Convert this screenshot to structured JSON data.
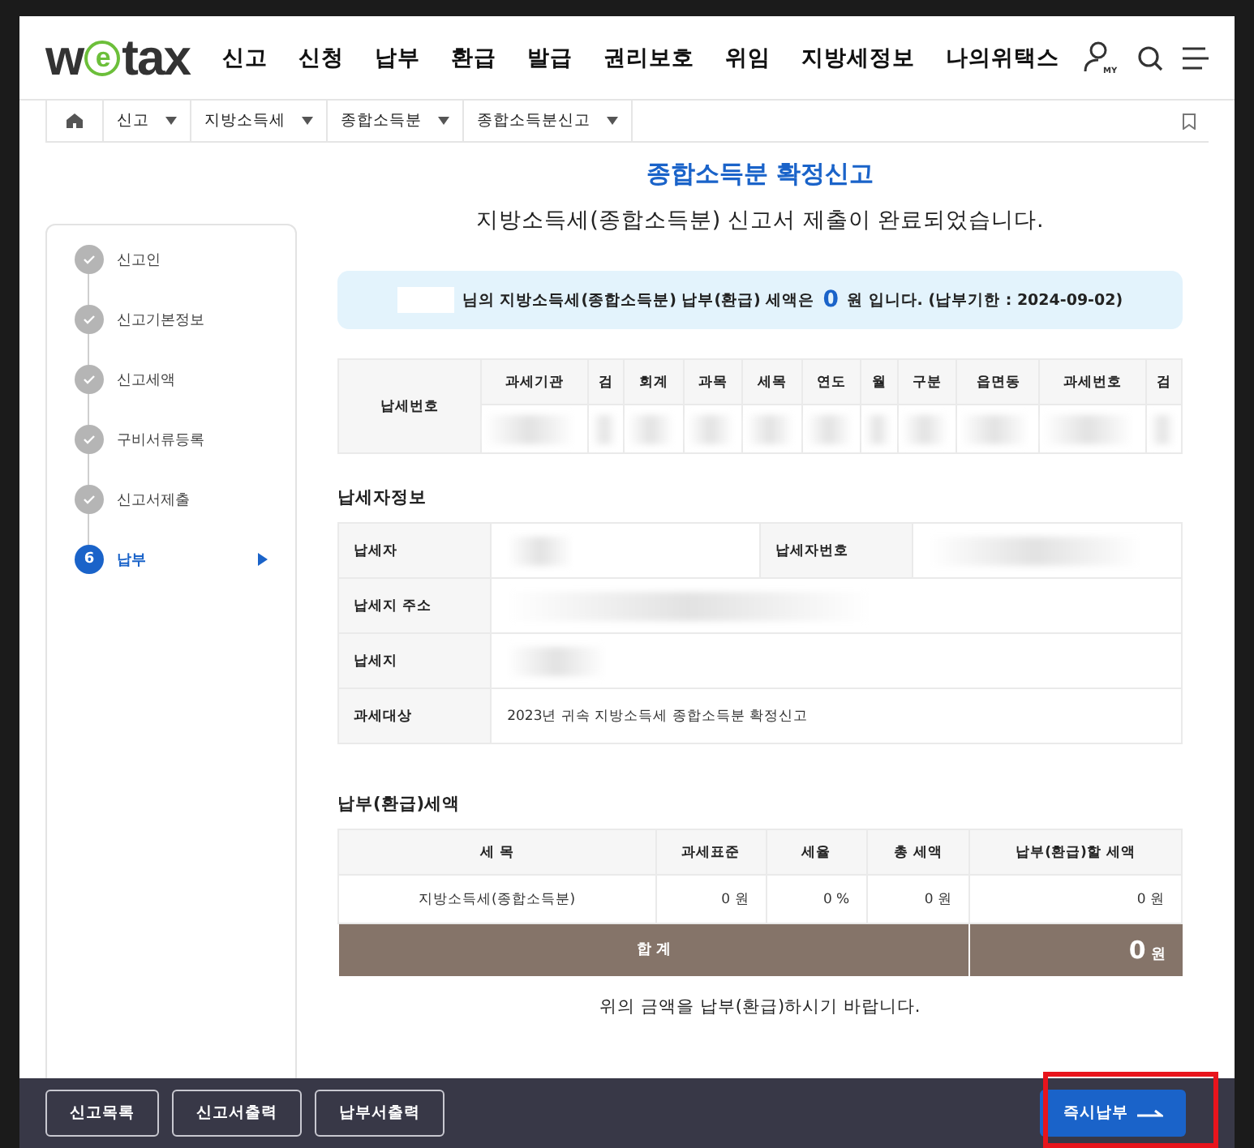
{
  "logo": {
    "before": "w",
    "mark": "e",
    "after": "tax"
  },
  "nav": [
    "신고",
    "신청",
    "납부",
    "환급",
    "발급",
    "권리보호",
    "위임",
    "지방세정보",
    "나의위택스"
  ],
  "my_label": "MY",
  "breadcrumb": [
    "신고",
    "지방소득세",
    "종합소득분",
    "종합소득분신고"
  ],
  "steps": [
    {
      "label": "신고인",
      "done": true,
      "selected": false
    },
    {
      "label": "신고기본정보",
      "done": true,
      "selected": false
    },
    {
      "label": "신고세액",
      "done": true,
      "selected": false
    },
    {
      "label": "구비서류등록",
      "done": true,
      "selected": false
    },
    {
      "label": "신고서제출",
      "done": true,
      "selected": false
    },
    {
      "label": "납부",
      "done": false,
      "selected": true,
      "number": "6"
    }
  ],
  "title": "종합소득분 확정신고",
  "subtitle": "지방소득세(종합소득분) 신고서 제출이 완료되었습니다.",
  "notice": {
    "before": "님의 지방소득세(종합소득분) 납부(환급) 세액은",
    "amount": "0",
    "after": "원 입니다. (납부기한 : 2024-09-02)"
  },
  "tax_number": {
    "label": "납세번호",
    "columns": [
      "과세기관",
      "검",
      "회계",
      "과목",
      "세목",
      "연도",
      "월",
      "구분",
      "읍면동",
      "과세번호",
      "검"
    ]
  },
  "taxpayer": {
    "heading": "납세자정보",
    "rows": [
      {
        "label": "납세자",
        "second_label": "납세자번호"
      },
      {
        "label": "납세지 주소"
      },
      {
        "label": "납세지"
      },
      {
        "label": "과세대상",
        "value": "2023년 귀속 지방소득세 종합소득분 확정신고"
      }
    ]
  },
  "amounts": {
    "heading": "납부(환급)세액",
    "columns": [
      "세 목",
      "과세표준",
      "세율",
      "총 세액",
      "납부(환급)할 세액"
    ],
    "row": [
      "지방소득세(종합소득분)",
      "0 원",
      "0 %",
      "0 원",
      "0 원"
    ],
    "total_label": "합 계",
    "total_value": "0",
    "total_unit": "원"
  },
  "note": "위의 금액을 납부(환급)하시기 바랍니다.",
  "footer_buttons": [
    "신고목록",
    "신고서출력",
    "납부서출력"
  ],
  "pay_button": "즉시납부"
}
